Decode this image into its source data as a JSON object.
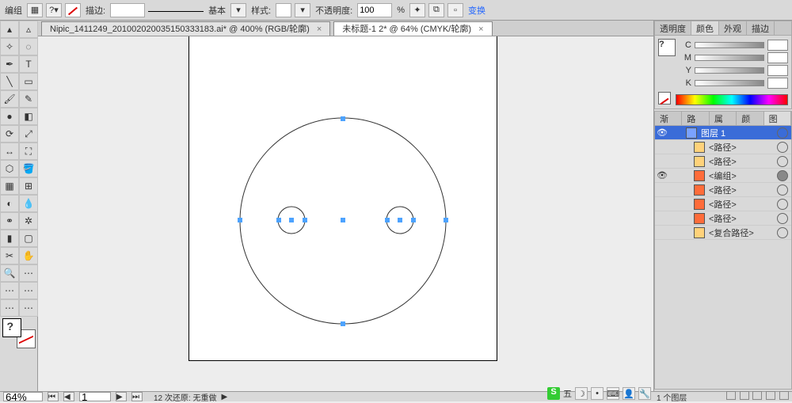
{
  "topbar": {
    "group_label": "编组",
    "stroke_label": "描边:",
    "stroke_val": "",
    "basic_label": "基本",
    "style_label": "样式:",
    "opacity_label": "不透明度:",
    "opacity_val": "100",
    "opacity_pct": "%",
    "transform_link": "变换"
  },
  "tabs": [
    {
      "label": "Nipic_1411249_201002020035150333183.ai* @ 400%  (RGB/轮廓)",
      "active": false
    },
    {
      "label": "未标题-1 2* @ 64%  (CMYK/轮廓)",
      "active": true
    }
  ],
  "right": {
    "panel1_tabs": [
      "透明度",
      "颜色",
      "外观",
      "描边"
    ],
    "panel1_active": 1,
    "cmyk": {
      "C": "",
      "M": "",
      "Y": "",
      "K": ""
    },
    "panel2_tabs": [
      "渐变",
      "路径",
      "属性",
      "颜色",
      "图层"
    ],
    "panel2_active": 4,
    "layers": [
      {
        "eye": true,
        "color": "#7aa2ff",
        "name": "图层 1",
        "selected": true,
        "indent": 0,
        "target": true
      },
      {
        "eye": false,
        "color": "#ffd27a",
        "name": "<路径>",
        "selected": false,
        "indent": 1,
        "target": true
      },
      {
        "eye": false,
        "color": "#ffd27a",
        "name": "<路径>",
        "selected": false,
        "indent": 1,
        "target": true
      },
      {
        "eye": true,
        "color": "#ff6c3a",
        "name": "<编组>",
        "selected": false,
        "indent": 1,
        "target": true,
        "filled": true
      },
      {
        "eye": false,
        "color": "#ff6c3a",
        "name": "<路径>",
        "selected": false,
        "indent": 1,
        "target": true
      },
      {
        "eye": false,
        "color": "#ff6c3a",
        "name": "<路径>",
        "selected": false,
        "indent": 1,
        "target": true
      },
      {
        "eye": false,
        "color": "#ff6c3a",
        "name": "<路径>",
        "selected": false,
        "indent": 1,
        "target": true
      },
      {
        "eye": false,
        "color": "#ffd27a",
        "name": "<复合路径>",
        "selected": false,
        "indent": 1,
        "target": true
      }
    ],
    "layer_footer": "1 个图层"
  },
  "status": {
    "zoom": "64%",
    "page": "1",
    "undo_msg": "12 次还原: 无重做"
  },
  "ime": {
    "s": "S",
    "label": "五"
  }
}
